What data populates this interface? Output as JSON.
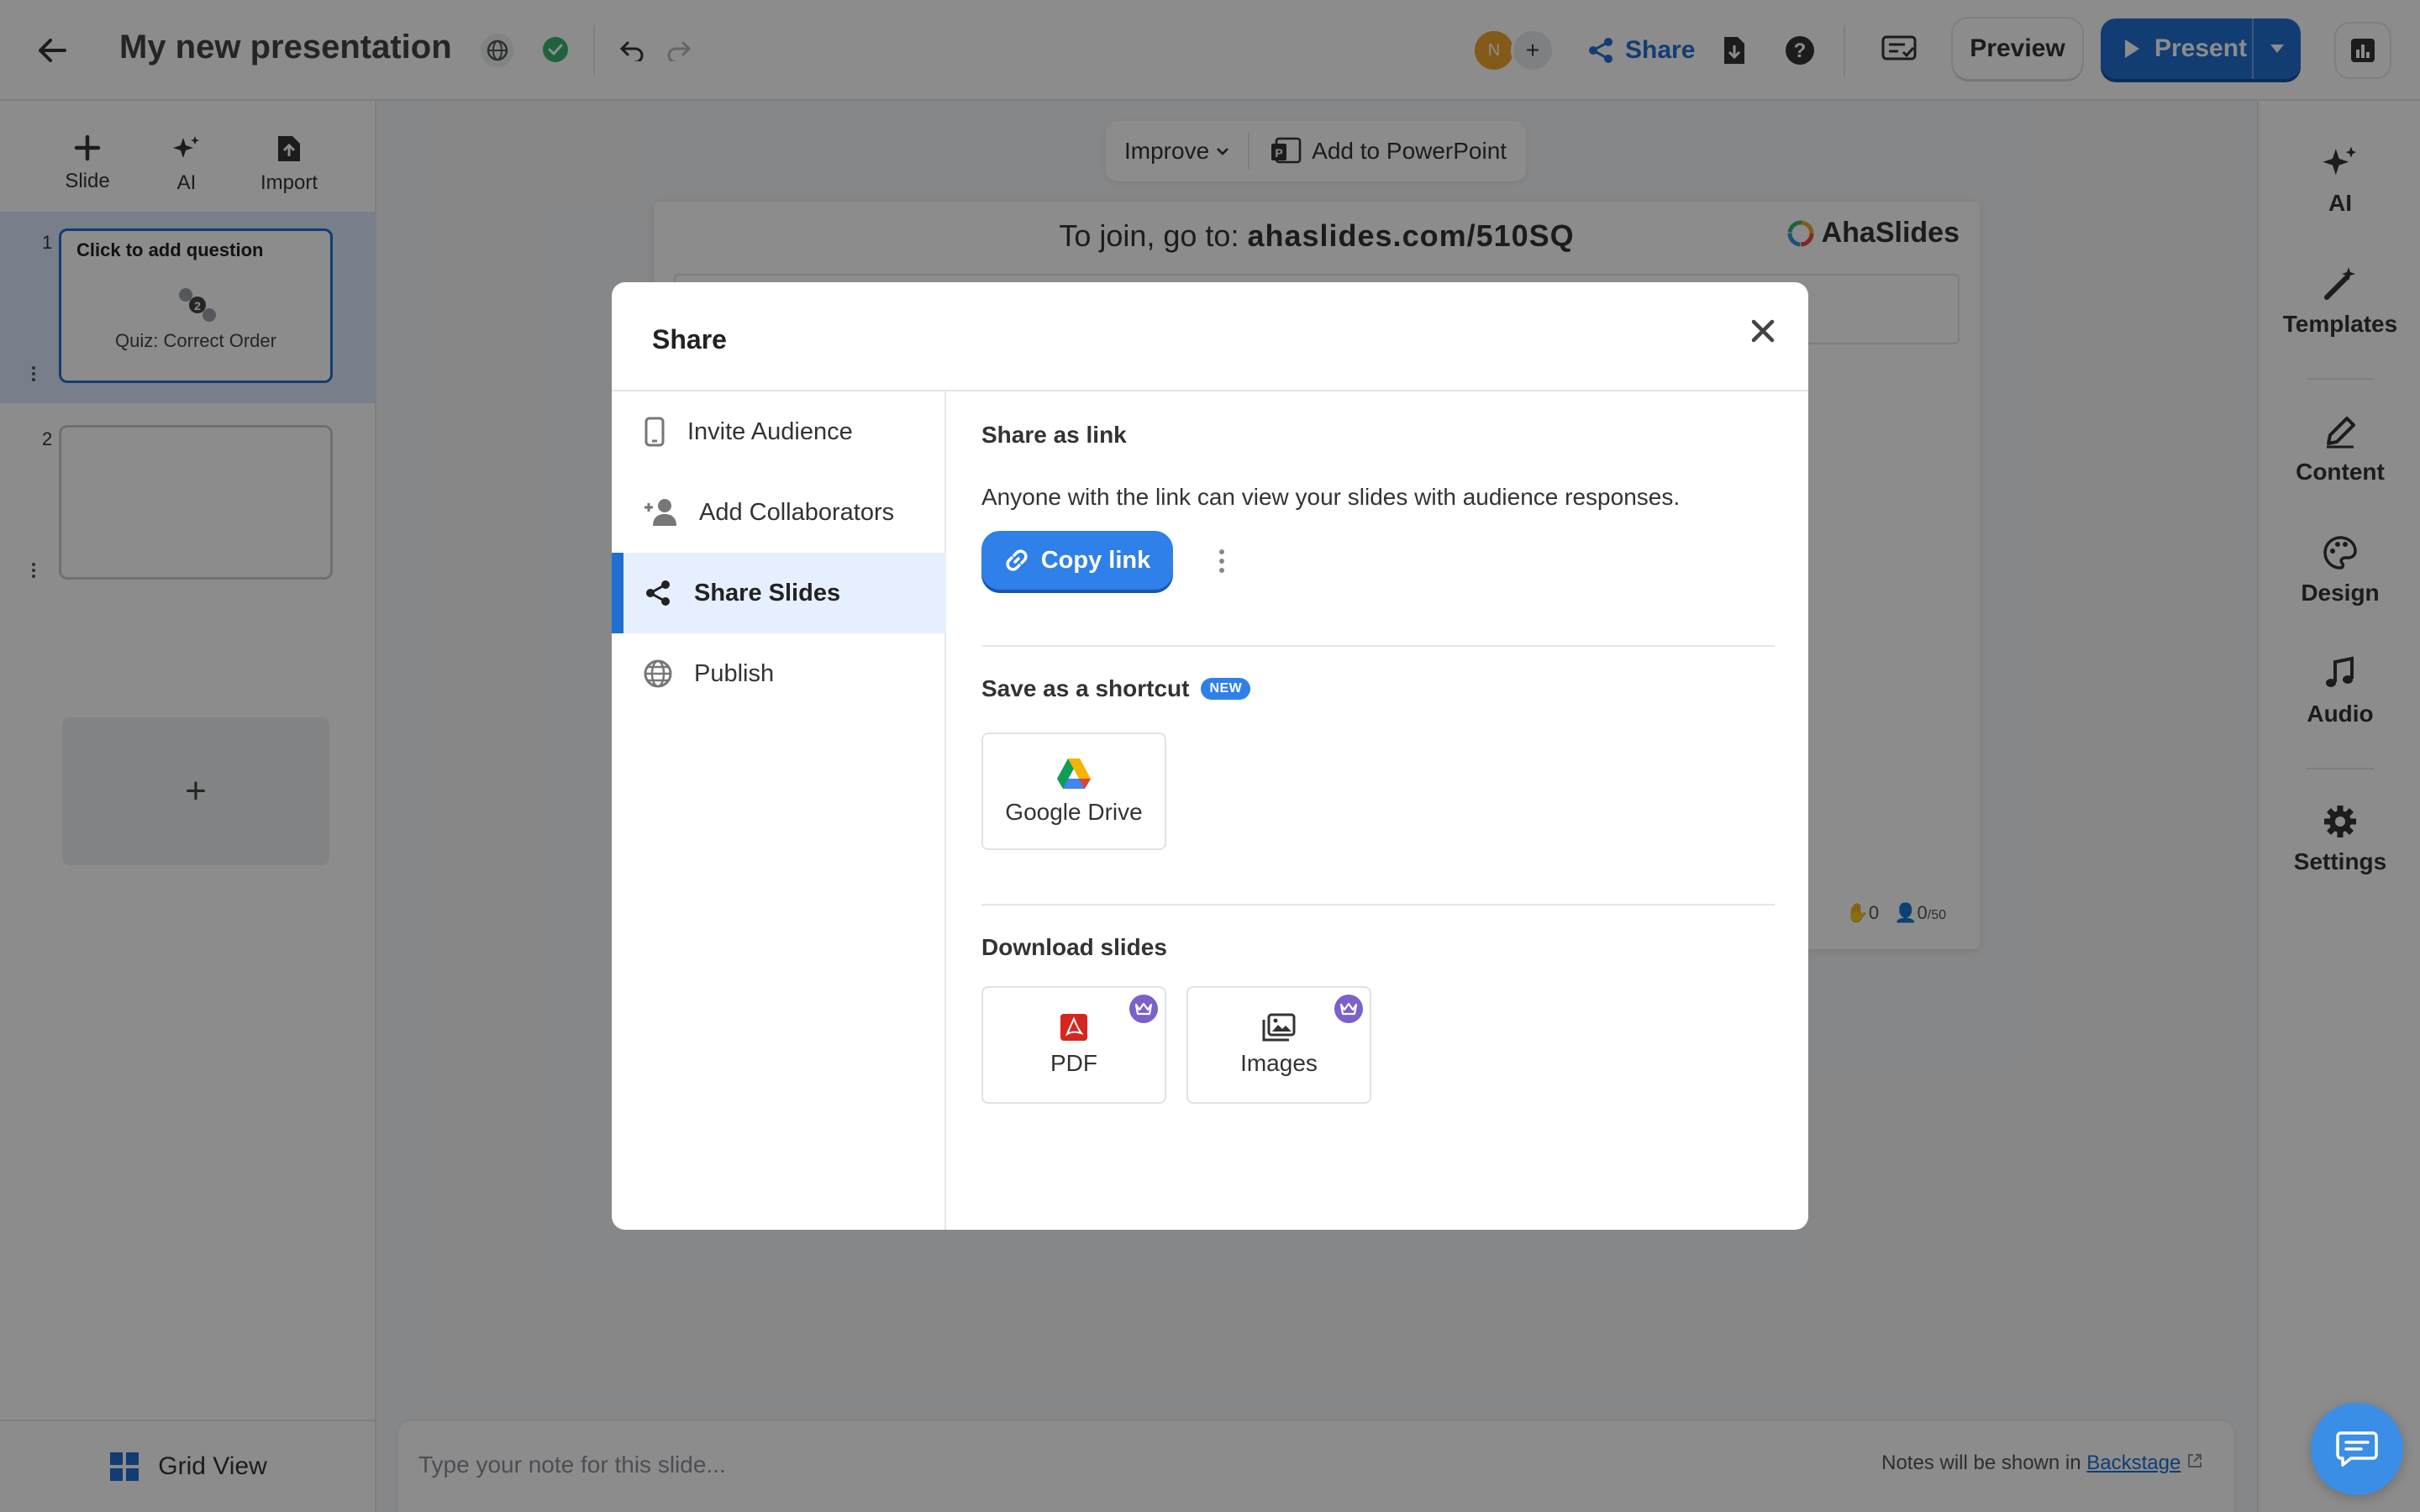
{
  "header": {
    "title": "My new presentation",
    "share_label": "Share",
    "preview_label": "Preview",
    "present_label": "Present",
    "avatar_initial": "N",
    "avatar_add": "+"
  },
  "left_panel": {
    "tools": [
      {
        "label": "Slide",
        "icon": "plus-icon"
      },
      {
        "label": "AI",
        "icon": "sparkles-icon"
      },
      {
        "label": "Import",
        "icon": "file-import-icon"
      }
    ],
    "slides": [
      {
        "number": "1",
        "question": "Click to add question",
        "type": "Quiz: Correct Order"
      },
      {
        "number": "2",
        "question": "",
        "type": ""
      }
    ],
    "add_slide": "+",
    "grid_view_label": "Grid View"
  },
  "canvas_toolbar": {
    "improve_label": "Improve",
    "ppt_label": "Add to PowerPoint"
  },
  "slide": {
    "join_prefix": "To join, go to:",
    "join_url": "ahaslides.com/510SQ",
    "brand": "AhaSlides",
    "hands_count": "0",
    "audience_count": "0",
    "audience_max": "/50"
  },
  "notes": {
    "placeholder": "Type your note for this slide...",
    "hint_prefix": "Notes will be shown in",
    "hint_link": "Backstage"
  },
  "right_panel": {
    "items": [
      {
        "label": "AI",
        "icon": "sparkles-icon"
      },
      {
        "label": "Templates",
        "icon": "magic-wand-icon"
      },
      {
        "label": "Content",
        "icon": "pencil-icon"
      },
      {
        "label": "Design",
        "icon": "palette-icon"
      },
      {
        "label": "Audio",
        "icon": "music-note-icon"
      },
      {
        "label": "Settings",
        "icon": "gear-icon"
      }
    ]
  },
  "modal": {
    "title": "Share",
    "nav": [
      {
        "label": "Invite Audience",
        "icon": "phone-icon"
      },
      {
        "label": "Add Collaborators",
        "icon": "add-user-icon"
      },
      {
        "label": "Share Slides",
        "icon": "share-icon",
        "active": true
      },
      {
        "label": "Publish",
        "icon": "globe-icon"
      }
    ],
    "share_link": {
      "title": "Share as link",
      "description": "Anyone with the link can view your slides with audience responses.",
      "copy_label": "Copy link"
    },
    "shortcut": {
      "title": "Save as a shortcut",
      "badge": "NEW",
      "google_drive_label": "Google Drive"
    },
    "download": {
      "title": "Download slides",
      "pdf_label": "PDF",
      "images_label": "Images"
    }
  },
  "colors": {
    "accent": "#1f6fd1",
    "copy_button": "#2f80e8",
    "premium_crown": "#7b61c9",
    "active_nav_bg": "#e5effd"
  }
}
